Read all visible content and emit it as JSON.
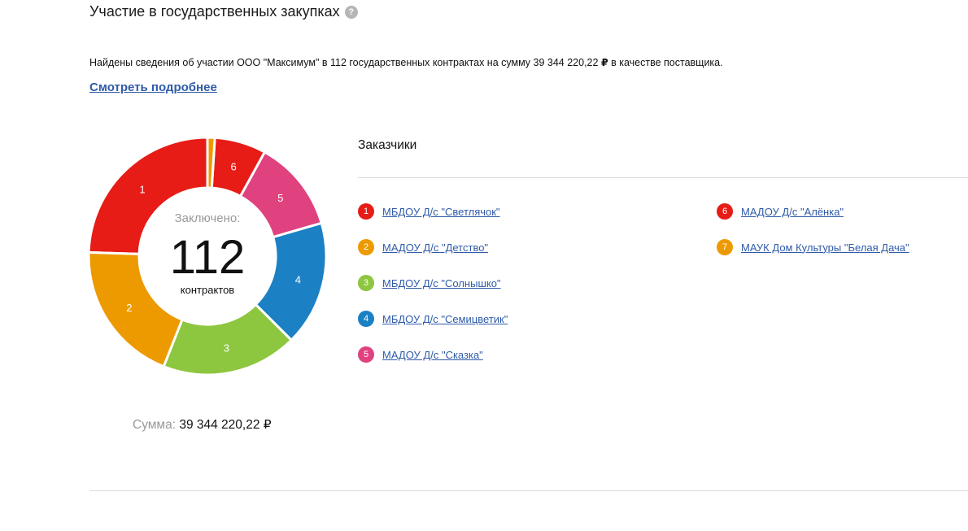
{
  "header": {
    "title": "Участие в государственных закупках",
    "help_icon": "?"
  },
  "summary": {
    "text_before": "Найдены сведения об участии ООО \"Максимум\" в 112 государственных контрактах на сумму 39 344 220,22 ",
    "currency": "₽",
    "text_after": " в качестве поставщика."
  },
  "more_link": "Смотреть подробнее",
  "center": {
    "label": "Заключено:",
    "value": "112",
    "unit": "контрактов"
  },
  "sum": {
    "label": "Сумма:",
    "value": "39 344 220,22 ₽"
  },
  "legend": {
    "title": "Заказчики"
  },
  "chart_data": {
    "type": "pie",
    "title": "",
    "total_label": "112",
    "categories": [
      "МБДОУ Д/с \"Светлячок\"",
      "МАДОУ Д/с \"Детство\"",
      "МБДОУ Д/с \"Солнышко\"",
      "МБДОУ Д/с \"Семицветик\"",
      "МАДОУ Д/с \"Сказка\"",
      "МАДОУ Д/с \"Алёнка\"",
      "МАУК Дом Культуры \"Белая Дача\""
    ],
    "slice_labels": [
      "1",
      "2",
      "3",
      "4",
      "5",
      "6",
      "7"
    ],
    "values": [
      24.5,
      19.5,
      18.5,
      17.0,
      12.5,
      7.0,
      1.0
    ],
    "colors": [
      "#e71c16",
      "#ec9a00",
      "#8dc63f",
      "#1b80c4",
      "#e0427f",
      "#e71c16",
      "#ec9a00"
    ],
    "start_angle_deg": 0,
    "direction": "counter-clockwise"
  }
}
